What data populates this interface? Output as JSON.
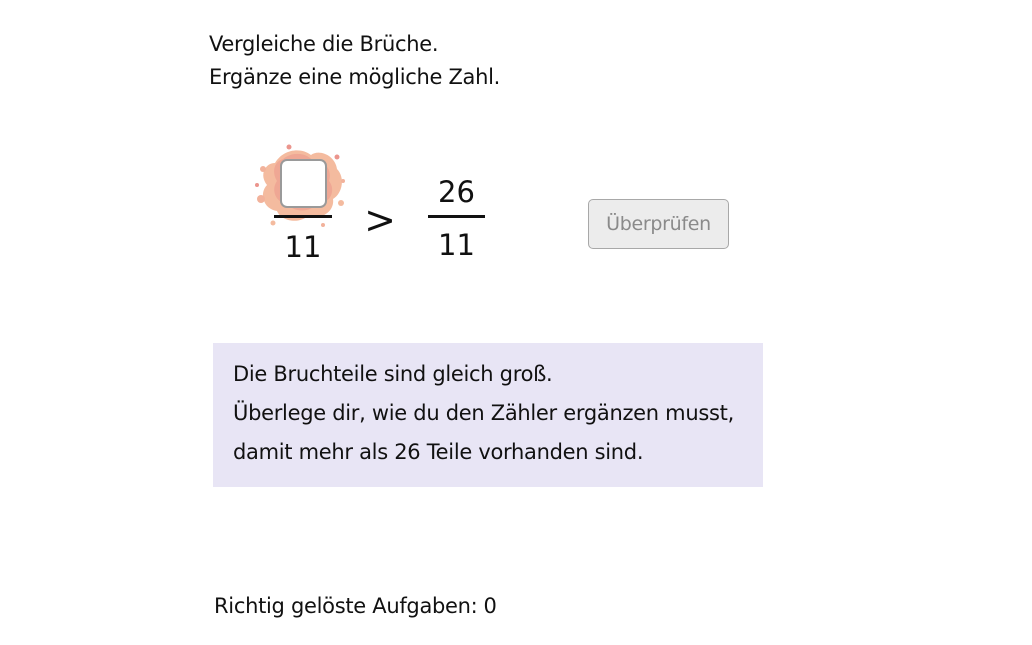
{
  "instructions": {
    "line1": "Vergleiche die Brüche.",
    "line2": "Ergänze eine mögliche Zahl."
  },
  "left_fraction": {
    "numerator_value": "",
    "denominator": "11"
  },
  "comparator": ">",
  "right_fraction": {
    "numerator": "26",
    "denominator": "11"
  },
  "check_button": {
    "label": "Überprüfen",
    "state": "disabled"
  },
  "hint": {
    "line1": "Die Bruchteile sind gleich groß.",
    "line2": "Überlege dir, wie du den Zähler ergänzen musst,",
    "line3": "damit mehr als 26 Teile vorhanden sind."
  },
  "score": {
    "label": "Richtig gelöste Aufgaben:",
    "count": "0"
  },
  "colors": {
    "hint_background": "#e8e5f5",
    "splash_primary": "#f0a58a",
    "splash_secondary": "#e8837a",
    "button_background": "#ececec",
    "button_text": "#8a8a8a"
  }
}
